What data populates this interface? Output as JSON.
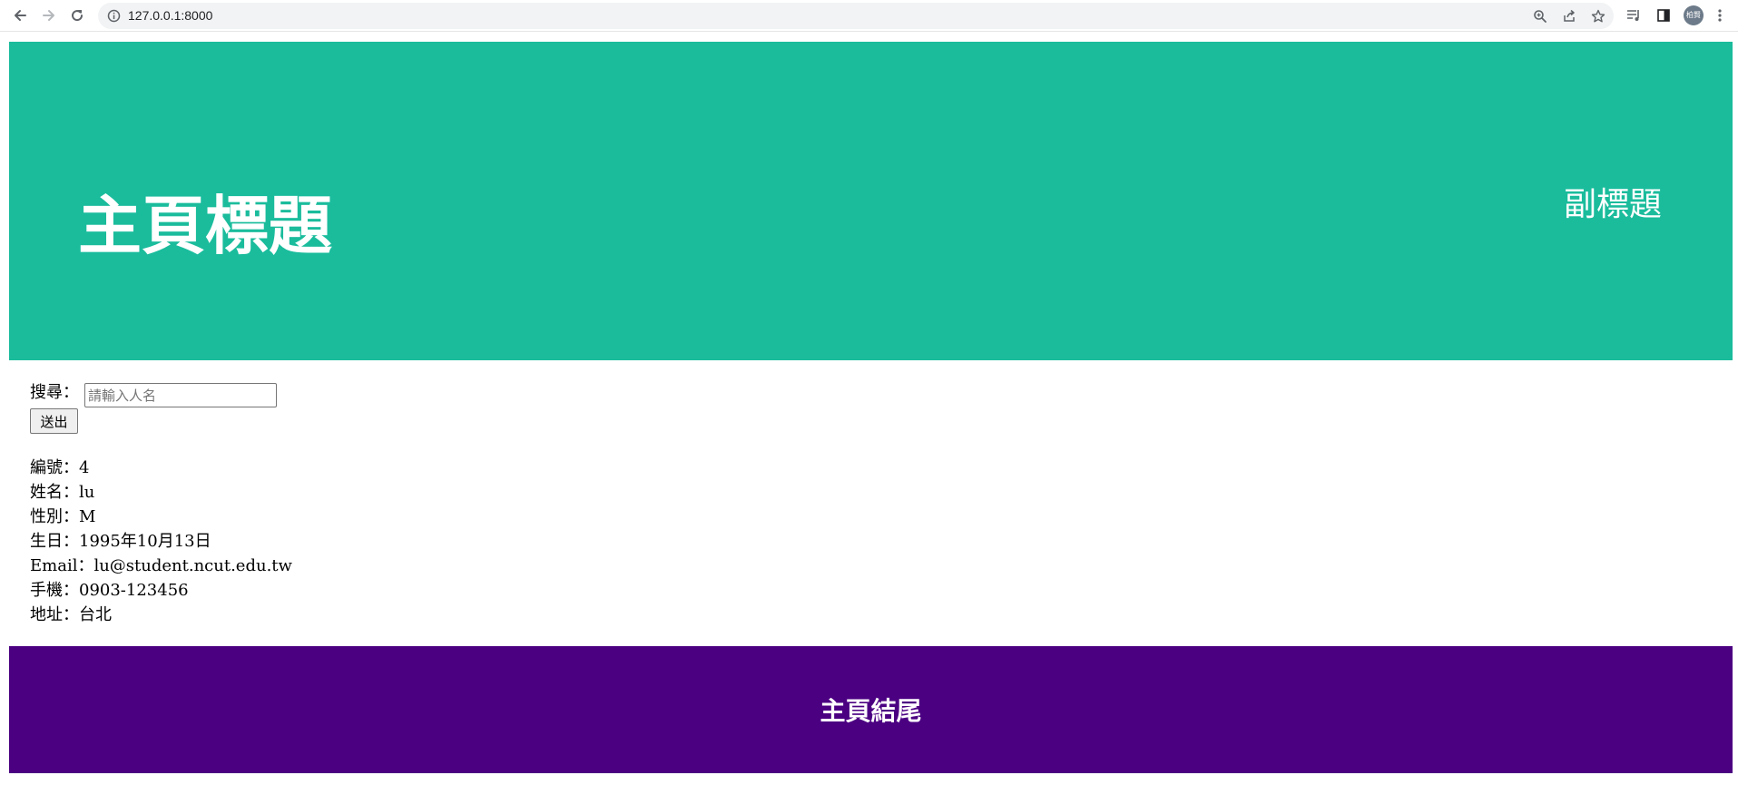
{
  "browser": {
    "url": "127.0.0.1:8000",
    "profile_initials": "柏賢"
  },
  "header": {
    "title": "主頁標題",
    "subtitle": "副標題",
    "background": "#1abc9c"
  },
  "search": {
    "label": "搜尋：",
    "placeholder": "請輸入人名",
    "value": "",
    "submit_label": "送出"
  },
  "person": [
    {
      "label": "編號：",
      "value": "4"
    },
    {
      "label": "姓名：",
      "value": "lu"
    },
    {
      "label": "性別：",
      "value": "M"
    },
    {
      "label": "生日：",
      "value": "1995年10月13日"
    },
    {
      "label": "Email：",
      "value": "lu@student.ncut.edu.tw"
    },
    {
      "label": "手機：",
      "value": "0903-123456"
    },
    {
      "label": "地址：",
      "value": "台北"
    }
  ],
  "footer": {
    "text": "主頁結尾",
    "background": "#4b0082"
  },
  "icons": {
    "back": "arrow-left-icon",
    "forward": "arrow-right-icon",
    "reload": "reload-icon",
    "site_info": "info-icon",
    "zoom": "zoom-icon",
    "share": "share-icon",
    "bookmark": "star-icon",
    "media": "media-control-icon",
    "side_panel": "side-panel-icon",
    "menu": "kebab-menu-icon"
  }
}
